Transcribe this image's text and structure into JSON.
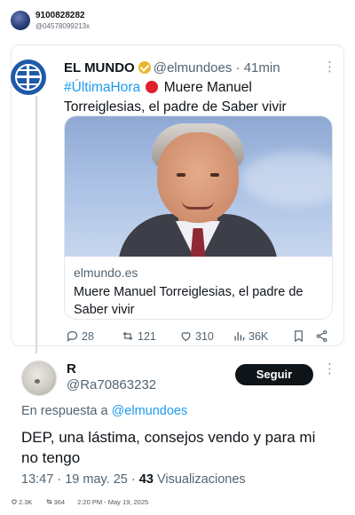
{
  "header": {
    "name": "9100828282",
    "handle": "@04578099213x"
  },
  "tweet": {
    "author_name": "EL MUNDO",
    "author_handle": "@elmundoes",
    "separator": "·",
    "time": "41min",
    "hashtag": "#ÚltimaHora",
    "text": "Muere Manuel Torreiglesias, el padre de Saber vivir",
    "more": "⋮",
    "link": {
      "domain": "elmundo.es",
      "title": "Muere Manuel Torreiglesias, el padre de Saber vivir"
    },
    "stats": {
      "replies": "28",
      "retweets": "121",
      "likes": "310",
      "views": "36K"
    }
  },
  "reply": {
    "author_name": "R",
    "author_handle": "@Ra70863232",
    "follow_label": "Seguir",
    "more": "⋮",
    "in_reply_prefix": "En respuesta a",
    "in_reply_mention": "@elmundoes",
    "text": "DEP, una lástima, consejos vendo y para mi no tengo",
    "time": "13:47",
    "separator": "·",
    "date": "19 may. 25",
    "dot2": "·",
    "views_count": "43",
    "views_label": "Visualizaciones"
  },
  "footer": {
    "likes": "2.3K",
    "retweets": "364",
    "timestamp": "2:20 PM - May 19, 2025"
  },
  "colors": {
    "link_blue": "#1d9bf0",
    "verified_gold": "#e8b72c",
    "text_dark": "#0f1419",
    "text_muted": "#536471"
  }
}
